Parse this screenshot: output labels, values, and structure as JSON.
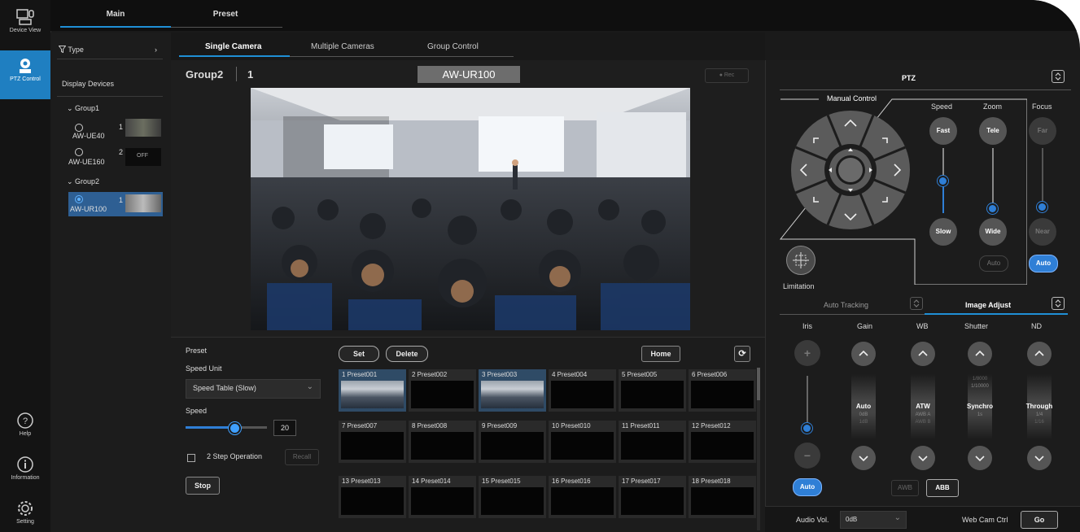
{
  "rail": {
    "device_view": "Device View",
    "ptz_control": "PTZ Control",
    "help": "Help",
    "information": "Information",
    "setting": "Setting"
  },
  "top_tabs": [
    "Main",
    "Preset"
  ],
  "device_list": {
    "filter_label": "Type",
    "header": "Display Devices",
    "groups": [
      {
        "name": "Group1",
        "devices": [
          {
            "num": "1",
            "model": "AW-UE40",
            "status": ""
          },
          {
            "num": "2",
            "model": "AW-UE160",
            "status": "OFF"
          }
        ]
      },
      {
        "name": "Group2",
        "devices": [
          {
            "num": "1",
            "model": "AW-UR100",
            "status": ""
          }
        ]
      }
    ]
  },
  "sub_tabs": [
    "Single Camera",
    "Multiple Cameras",
    "Group Control"
  ],
  "camera": {
    "group": "Group2",
    "number": "1",
    "model": "AW-UR100",
    "rec_label": "● Rec"
  },
  "preset": {
    "title": "Preset",
    "speed_unit_label": "Speed Unit",
    "speed_unit_value": "Speed Table (Slow)",
    "speed_label": "Speed",
    "speed_value": "20",
    "speed_fraction": 0.6,
    "two_step_label": "2 Step Operation",
    "recall_label": "Recall",
    "stop_label": "Stop",
    "set_label": "Set",
    "delete_label": "Delete",
    "home_label": "Home",
    "cells": [
      {
        "num": "1",
        "name": "Preset001"
      },
      {
        "num": "2",
        "name": "Preset002"
      },
      {
        "num": "3",
        "name": "Preset003"
      },
      {
        "num": "4",
        "name": "Preset004"
      },
      {
        "num": "5",
        "name": "Preset005"
      },
      {
        "num": "6",
        "name": "Preset006"
      },
      {
        "num": "7",
        "name": "Preset007"
      },
      {
        "num": "8",
        "name": "Preset008"
      },
      {
        "num": "9",
        "name": "Preset009"
      },
      {
        "num": "10",
        "name": "Preset010"
      },
      {
        "num": "11",
        "name": "Preset011"
      },
      {
        "num": "12",
        "name": "Preset012"
      },
      {
        "num": "13",
        "name": "Preset013"
      },
      {
        "num": "14",
        "name": "Preset014"
      },
      {
        "num": "15",
        "name": "Preset015"
      },
      {
        "num": "16",
        "name": "Preset016"
      },
      {
        "num": "17",
        "name": "Preset017"
      },
      {
        "num": "18",
        "name": "Preset018"
      }
    ]
  },
  "ptz": {
    "title": "PTZ",
    "manual_control": "Manual Control",
    "speed_label": "Speed",
    "zoom_label": "Zoom",
    "focus_label": "Focus",
    "fast": "Fast",
    "slow": "Slow",
    "tele": "Tele",
    "wide": "Wide",
    "far": "Far",
    "near": "Near",
    "zoom_auto": "Auto",
    "focus_auto": "Auto",
    "limitation": "Limitation",
    "auto_tracking": "Auto Tracking",
    "image_adjust": "Image Adjust"
  },
  "image_adjust": {
    "columns": [
      "Iris",
      "Gain",
      "WB",
      "Shutter",
      "ND"
    ],
    "gain": {
      "value": "Auto",
      "sub1": "0dB",
      "sub2": "1dB"
    },
    "wb": {
      "value": "ATW",
      "sub1": "AWB A",
      "sub2": "AWB B"
    },
    "shutter": {
      "value": "Synchro",
      "top1": "1/8000",
      "top2": "1/10000",
      "sub1": "1s"
    },
    "nd": {
      "value": "Through",
      "sub1": "1/4",
      "sub2": "1/16"
    },
    "iris_auto": "Auto",
    "awb": "AWB",
    "abb": "ABB"
  },
  "bottom": {
    "audio_vol_label": "Audio Vol.",
    "audio_vol_value": "0dB",
    "web_cam_label": "Web Cam Ctrl",
    "go_label": "Go"
  }
}
